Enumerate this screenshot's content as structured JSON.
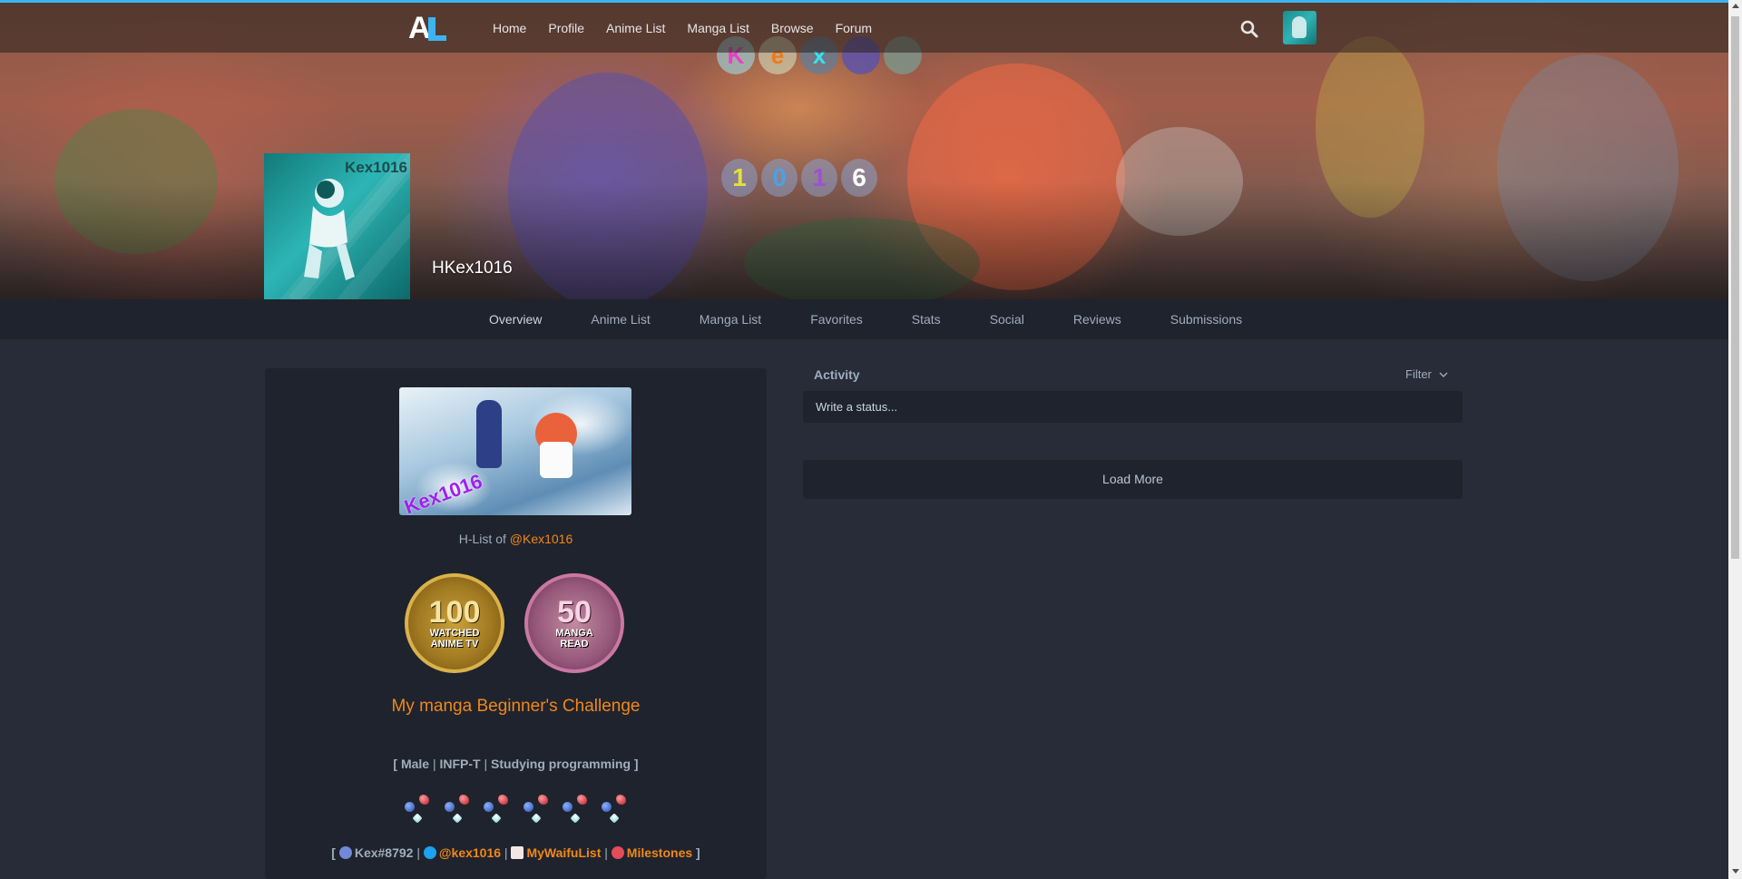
{
  "nav": {
    "links": [
      "Home",
      "Profile",
      "Anime List",
      "Manga List",
      "Browse",
      "Forum"
    ],
    "search_icon": "search-icon",
    "avatar_icon": "user-avatar"
  },
  "banner": {
    "title_letters": [
      "K",
      "e",
      "x",
      ""
    ],
    "number_letters": [
      "1",
      "0",
      "1",
      "6"
    ]
  },
  "profile": {
    "username": "HKex1016",
    "avatar_watermark": "Kex1016"
  },
  "tabs": [
    "Overview",
    "Anime List",
    "Manga List",
    "Favorites",
    "Stats",
    "Social",
    "Reviews",
    "Submissions"
  ],
  "about": {
    "image_watermark": "Kex1016",
    "hlist_prefix": "H-List of",
    "hlist_mention": "@Kex1016",
    "badge_anime": {
      "number": "100",
      "line1": "WATCHED",
      "line2": "ANIME TV"
    },
    "badge_manga": {
      "number": "50",
      "line1": "MANGA",
      "line2": "READ"
    },
    "challenge": "My manga Beginner's Challenge",
    "info": {
      "open": "[",
      "gender": "Male",
      "sep1": "|",
      "mbti": "INFP-T",
      "sep2": "|",
      "activity": "Studying programming",
      "close": "]"
    },
    "social": {
      "open": "[",
      "discord": "Kex#8792",
      "sep1": "|",
      "twitter": "@kex1016",
      "sep2": "|",
      "waifu": "MyWaifuList",
      "sep3": "|",
      "milestones": "Milestones",
      "close": "]"
    }
  },
  "activity": {
    "title": "Activity",
    "filter": "Filter",
    "status_placeholder": "Write a status...",
    "load_more": "Load More"
  },
  "colors": {
    "accent": "#3db4f2",
    "link_orange": "#ef881a",
    "panel": "#1f232d",
    "background": "#272c38"
  }
}
